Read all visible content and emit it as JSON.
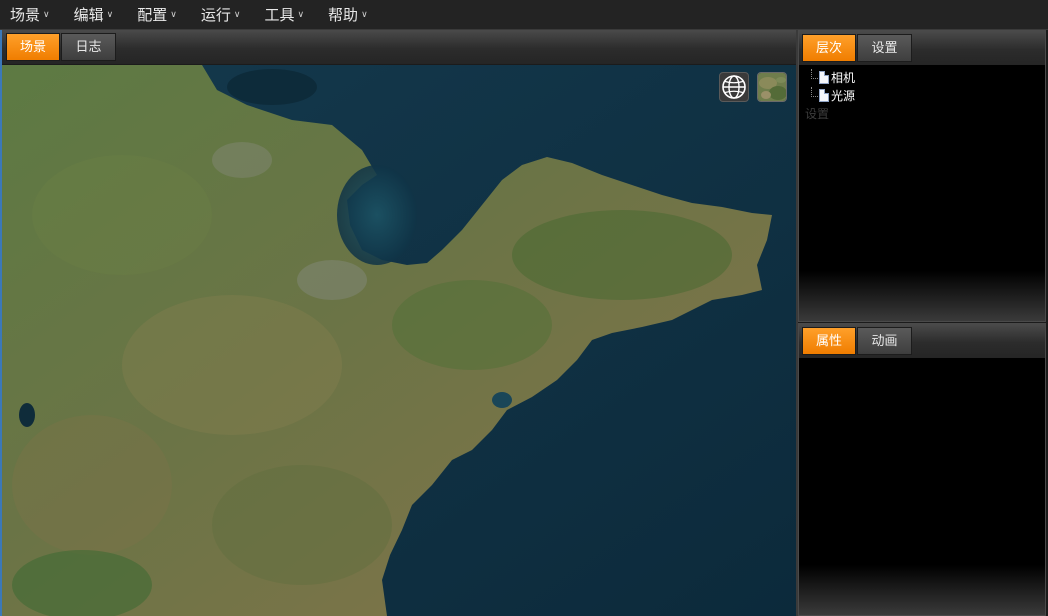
{
  "menubar": {
    "items": [
      "场景",
      "编辑",
      "配置",
      "运行",
      "工具",
      "帮助"
    ]
  },
  "left_panel": {
    "tabs": [
      "场景",
      "日志"
    ],
    "active_tab": "场景"
  },
  "map": {
    "buttons": [
      "globe-icon",
      "imagery-thumbnail-icon"
    ]
  },
  "hierarchy_panel": {
    "tabs": [
      "层次",
      "设置"
    ],
    "active_tab": "层次",
    "tree_items": [
      "相机",
      "光源"
    ],
    "ghost_label": "设置"
  },
  "property_panel": {
    "tabs": [
      "属性",
      "动画"
    ],
    "active_tab": "属性"
  },
  "colors": {
    "accent": "#f08a0f",
    "ocean": "#0f3346",
    "land": "#4f6a38"
  }
}
